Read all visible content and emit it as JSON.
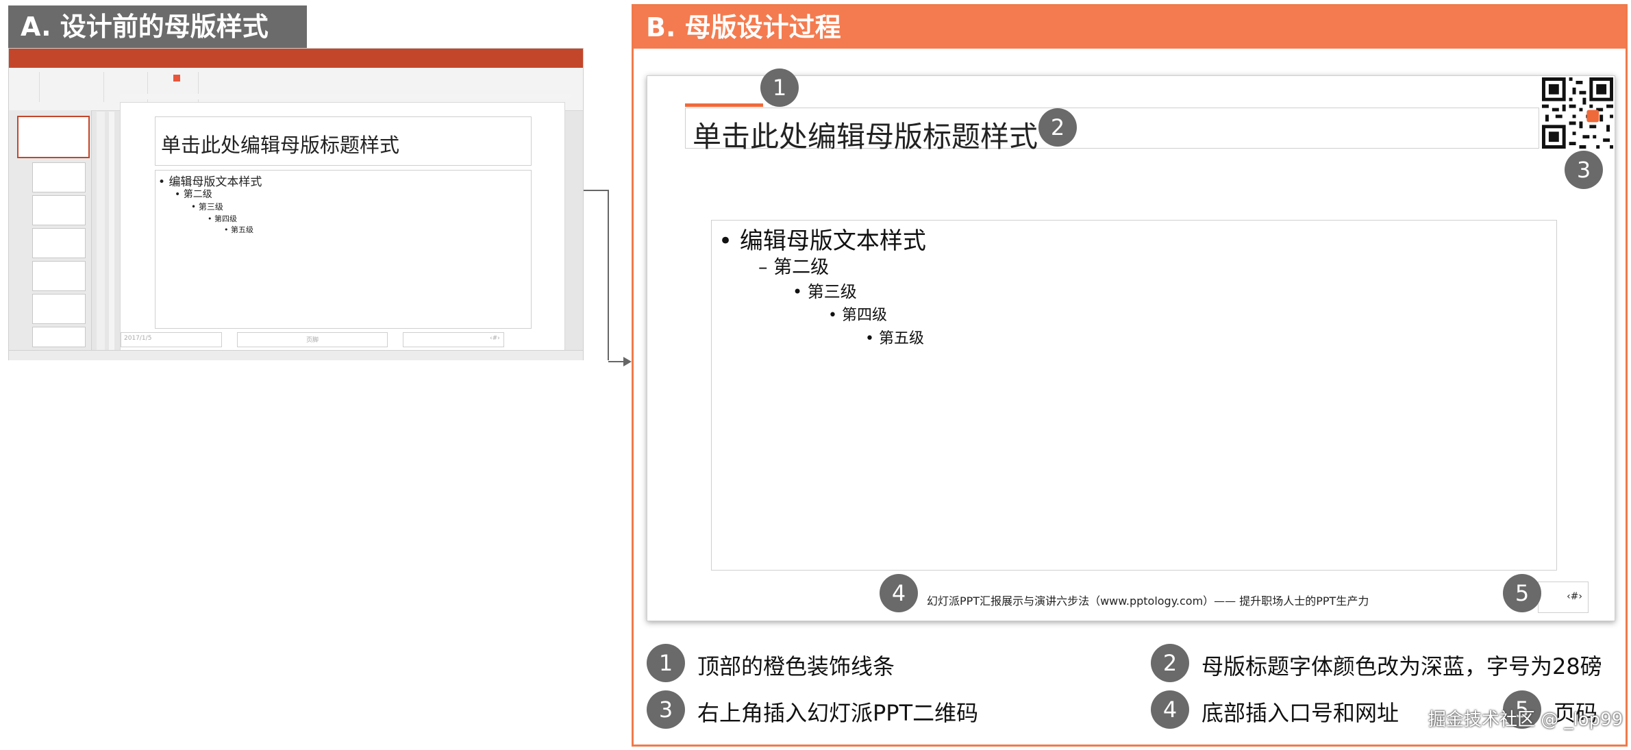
{
  "section_a": {
    "header": "A. 设计前的母版样式",
    "slide_title": "单击此处编辑母版标题样式",
    "body_levels": [
      "编辑母版文本样式",
      "第二级",
      "第三级",
      "第四级",
      "第五级"
    ],
    "footer_date": "2017/1/5",
    "footer_center": "页脚",
    "footer_page": "‹#›"
  },
  "section_b": {
    "header": "B. 母版设计过程",
    "slide_title": "单击此处编辑母版标题样式",
    "body_levels": [
      "编辑母版文本样式",
      "第二级",
      "第三级",
      "第四级",
      "第五级"
    ],
    "footer_text": "幻灯派PPT汇报展示与演讲六步法（www.pptology.com）—— 提升职场人士的PPT生产力",
    "page_number": "‹#›",
    "badges": [
      "1",
      "2",
      "3",
      "4",
      "5"
    ],
    "legend": [
      {
        "num": "1",
        "text": "顶部的橙色装饰线条"
      },
      {
        "num": "2",
        "text": "母版标题字体颜色改为深蓝，字号为28磅"
      },
      {
        "num": "3",
        "text": "右上角插入幻灯派PPT二维码"
      },
      {
        "num": "4",
        "text": "底部插入口号和网址"
      },
      {
        "num": "5",
        "text": "页码"
      }
    ]
  },
  "watermark": "掘金技术社区 @ _lop99",
  "colors": {
    "orange": "#f47b4f",
    "gray_header": "#6b6b6b",
    "ppt_red": "#c4462a",
    "badge": "#6a6a6a"
  }
}
